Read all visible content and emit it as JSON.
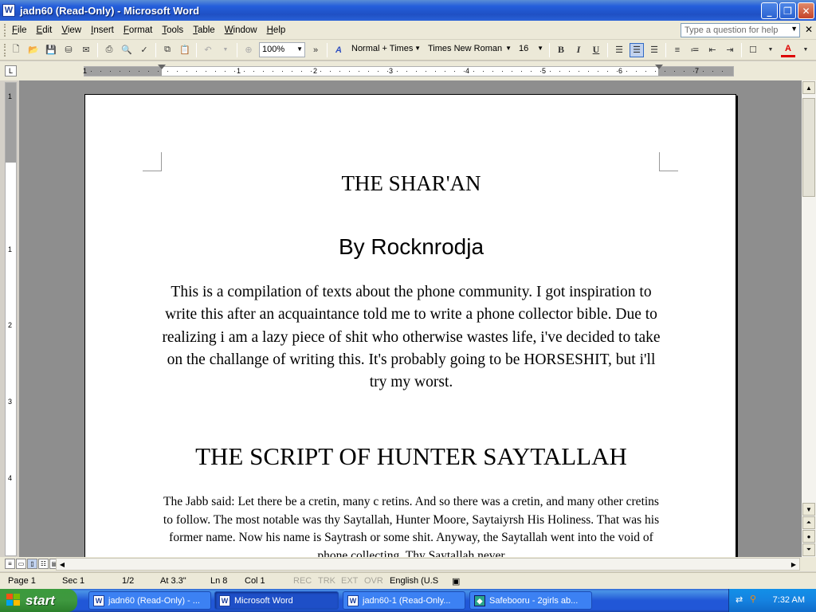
{
  "window": {
    "title": "jadn60 (Read-Only) - Microsoft Word",
    "icon": "W",
    "buttons": [
      "_",
      "❐",
      "✕"
    ]
  },
  "menu": {
    "items": [
      "File",
      "Edit",
      "View",
      "Insert",
      "Format",
      "Tools",
      "Table",
      "Window",
      "Help"
    ],
    "help_placeholder": "Type a question for help",
    "close": "✕"
  },
  "toolbar": {
    "zoom": "100%",
    "style": "Normal + Times",
    "font": "Times New Roman",
    "size": "16",
    "bold": "B",
    "italic": "I",
    "underline": "U",
    "font_color_label": "A",
    "more": "»",
    "font_color_hex": "#d00000"
  },
  "ruler": {
    "tab_selector": "L",
    "numbers": [
      "1",
      "1",
      "2",
      "3",
      "4",
      "5",
      "6",
      "7"
    ],
    "vertical_numbers": [
      "1",
      "1",
      "2",
      "3",
      "4"
    ]
  },
  "document": {
    "title": "THE SHAR'AN",
    "byline": "By Rocknrodja",
    "intro": "This is a compilation of texts about the phone community. I got inspiration to write this after an acquaintance told me to write a phone collector bible. Due to realizing i am a lazy piece of shit who otherwise wastes life, i've decided to take on the challange of writing this. It's probably going to be HORSESHIT, but i'll try my worst.",
    "section_title": "THE SCRIPT OF HUNTER SAYTALLAH",
    "section_text": "The Jabb said: Let there be a cretin, many c retins. And so there was a cretin, and many other cretins to follow. The most notable was thy Saytallah, Hunter Moore, Saytaiyrsh His Holiness. That was his former name. Now his name is Saytrash or some shit. Anyway, the Saytallah went into the void of phone collecting. Thy Saytallah never"
  },
  "statusbar": {
    "page": "Page 1",
    "sec": "Sec 1",
    "pages": "1/2",
    "at": "At 3.3\"",
    "ln": "Ln 8",
    "col": "Col 1",
    "rec": "REC",
    "trk": "TRK",
    "ext": "EXT",
    "ovr": "OVR",
    "lang": "English (U.S"
  },
  "taskbar": {
    "start": "start",
    "tasks": [
      "jadn60 (Read-Only) - ...",
      "Microsoft Word",
      "jadn60-1 (Read-Only...",
      "Safebooru - 2girls ab..."
    ],
    "clock": "7:32 AM"
  }
}
